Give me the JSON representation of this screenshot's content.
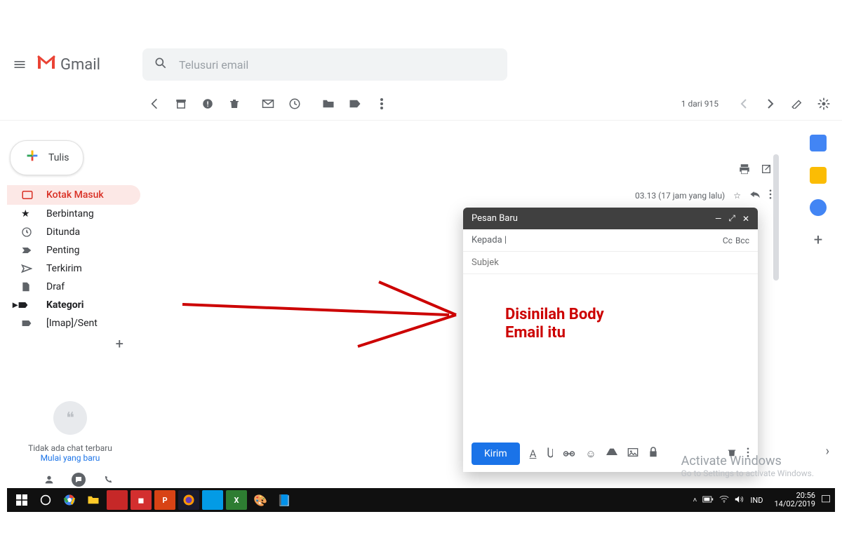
{
  "header": {
    "app_name": "Gmail",
    "search_placeholder": "Telusuri email"
  },
  "compose_button": "Tulis",
  "sidebar": {
    "items": [
      {
        "label": "Kotak Masuk"
      },
      {
        "label": "Berbintang"
      },
      {
        "label": "Ditunda"
      },
      {
        "label": "Penting"
      },
      {
        "label": "Terkirim"
      },
      {
        "label": "Draf"
      },
      {
        "label": "Kategori"
      },
      {
        "label": "[Imap]/Sent"
      }
    ]
  },
  "toolbar": {
    "counter": "1 dari 915"
  },
  "message": {
    "time": "03.13 (17 jam yang lalu)"
  },
  "compose": {
    "title": "Pesan Baru",
    "to_label": "Kepada",
    "cc": "Cc",
    "bcc": "Bcc",
    "subject_placeholder": "Subjek",
    "send": "Kirim"
  },
  "annotation": {
    "line1": "Disinilah Body",
    "line2": "Email itu"
  },
  "hangouts": {
    "empty": "Tidak ada chat terbaru",
    "start": "Mulai yang baru"
  },
  "watermark": {
    "title": "Activate Windows",
    "subtitle": "Go to Settings to activate Windows."
  },
  "taskbar": {
    "lang": "IND",
    "time": "20:56",
    "date": "14/02/2019"
  }
}
